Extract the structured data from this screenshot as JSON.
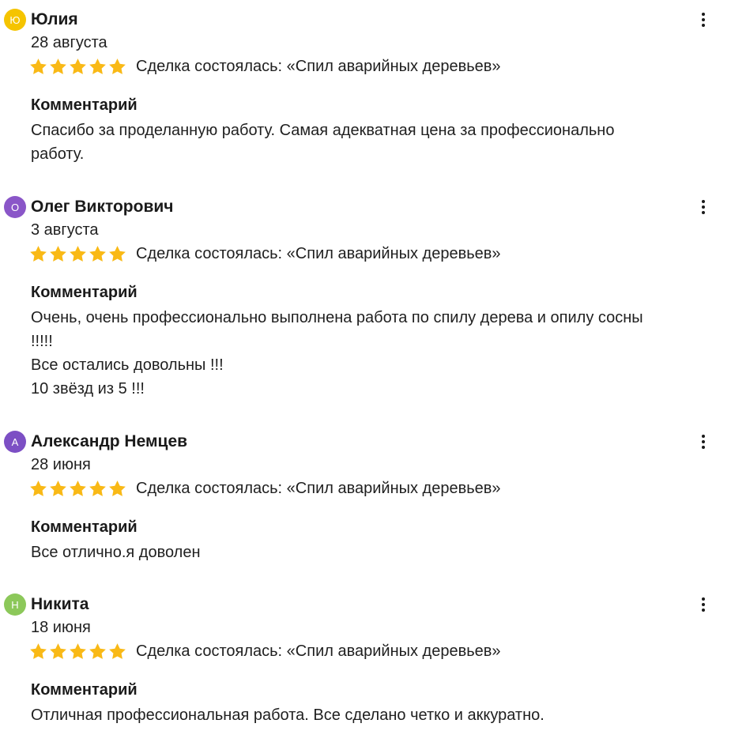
{
  "star_color": "#f9b916",
  "reviews": [
    {
      "avatar_letter": "Ю",
      "avatar_color": "#f5c400",
      "name": "Юлия",
      "date": "28 августа",
      "rating": 5,
      "deal": "Сделка состоялась: «Спил аварийных деревьев»",
      "comment_title": "Комментарий",
      "comment_lines": [
        "Спасибо за проделанную работу. Самая адекватная цена за профессионально",
        "работу."
      ]
    },
    {
      "avatar_letter": "О",
      "avatar_color": "#8a56c8",
      "name": "Олег Викторович",
      "date": "3 августа",
      "rating": 5,
      "deal": "Сделка состоялась: «Спил аварийных деревьев»",
      "comment_title": "Комментарий",
      "comment_lines": [
        "Очень, очень профессионально выполнена работа по спилу дерева и опилу сосны",
        "!!!!!",
        "Все остались довольны !!!",
        "10 звёзд из 5 !!!"
      ]
    },
    {
      "avatar_letter": "А",
      "avatar_color": "#7c4fc4",
      "name": "Александр Немцев",
      "date": "28 июня",
      "rating": 5,
      "deal": "Сделка состоялась: «Спил аварийных деревьев»",
      "comment_title": "Комментарий",
      "comment_lines": [
        "Все отлично.я доволен"
      ]
    },
    {
      "avatar_letter": "Н",
      "avatar_color": "#8cc85a",
      "name": "Никита",
      "date": "18 июня",
      "rating": 5,
      "deal": "Сделка состоялась: «Спил аварийных деревьев»",
      "comment_title": "Комментарий",
      "comment_lines": [
        "Отличная профессиональная работа. Все сделано четко и аккуратно."
      ]
    }
  ]
}
